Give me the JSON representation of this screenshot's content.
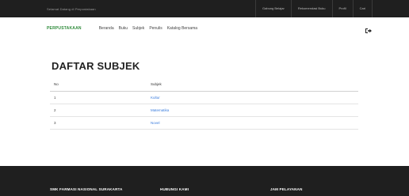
{
  "topbar": {
    "welcome": "Selamat Datang di Perpustakaan",
    "links": [
      "Gabung Belajar",
      "Rekomendasi Buku",
      "Profil",
      "Cari"
    ]
  },
  "navbar": {
    "brand": "PERPUSTAKAAN",
    "menu": [
      "Beranda",
      "Buku",
      "Subjek",
      "Penulis",
      "Katalog Bersama"
    ],
    "logout_icon": "logout-icon"
  },
  "page": {
    "title": "DAFTAR SUBJEK"
  },
  "table": {
    "headers": [
      "No",
      "Subjek"
    ],
    "rows": [
      {
        "no": "1",
        "subject": "Kultur"
      },
      {
        "no": "2",
        "subject": "Matematika"
      },
      {
        "no": "3",
        "subject": "Novel"
      }
    ]
  },
  "footer": {
    "columns": [
      "SMK FARMASI NASIONAL SURAKARTA",
      "HUBUNGI KAMI",
      "JAM PELAYANAN"
    ]
  }
}
